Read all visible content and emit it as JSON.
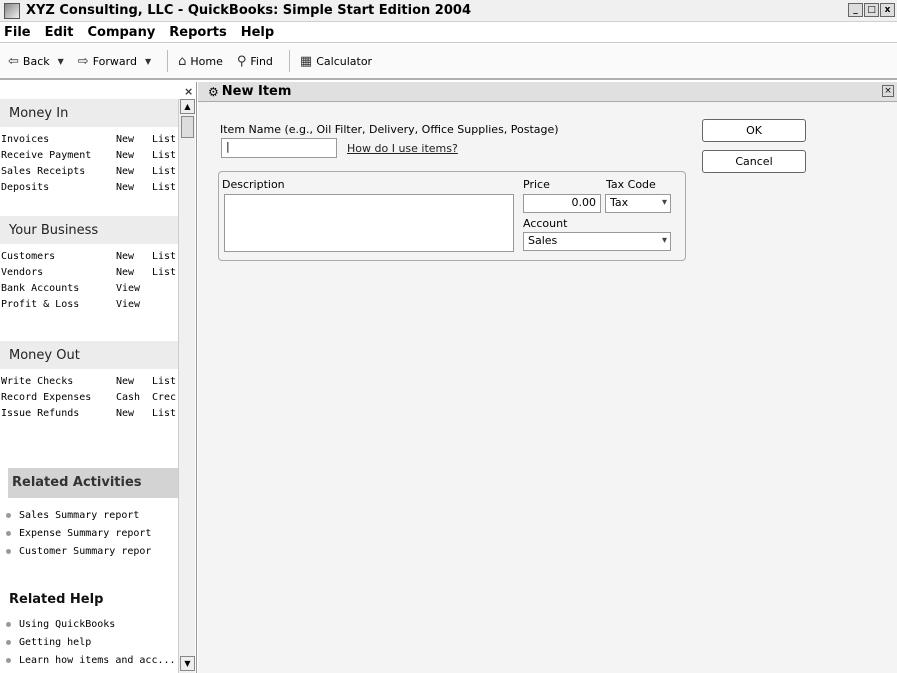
{
  "window": {
    "title": "XYZ Consulting, LLC - QuickBooks: Simple Start Edition 2004",
    "controls": [
      "_",
      "□",
      "x"
    ]
  },
  "menu": [
    "File",
    "Edit",
    "Company",
    "Reports",
    "Help"
  ],
  "toolbar": {
    "back": "Back",
    "forward": "Forward",
    "home": "Home",
    "find": "Find",
    "calculator": "Calculator"
  },
  "navigator": {
    "close": "×",
    "sections": [
      {
        "title": "Money In",
        "rows": [
          {
            "label": "Invoices",
            "a": "New",
            "b": "List"
          },
          {
            "label": "Receive Payment",
            "a": "New",
            "b": "List"
          },
          {
            "label": "Sales Receipts",
            "a": "New",
            "b": "List"
          },
          {
            "label": "Deposits",
            "a": "New",
            "b": "List"
          }
        ]
      },
      {
        "title": "Your Business",
        "rows": [
          {
            "label": "Customers",
            "a": "New",
            "b": "List"
          },
          {
            "label": "Vendors",
            "a": "New",
            "b": "List"
          },
          {
            "label": "Bank Accounts",
            "a": "View",
            "b": ""
          },
          {
            "label": "Profit & Loss",
            "a": "View",
            "b": ""
          }
        ]
      },
      {
        "title": "Money Out",
        "rows": [
          {
            "label": "Write Checks",
            "a": "New",
            "b": "List"
          },
          {
            "label": "Record Expenses",
            "a": "Cash",
            "b": "Crec"
          },
          {
            "label": "Issue Refunds",
            "a": "New",
            "b": "List"
          }
        ]
      }
    ],
    "related_activities": {
      "title": "Related Activities",
      "items": [
        "Sales Summary report",
        "Expense Summary report",
        "Customer Summary repor"
      ]
    },
    "related_help": {
      "title": "Related Help",
      "items": [
        "Using QuickBooks",
        "Getting help",
        "Learn how items and acc..."
      ]
    }
  },
  "new_item": {
    "title": "New Item",
    "item_name_label": "Item Name (e.g., Oil Filter, Delivery, Office Supplies, Postage)",
    "item_name_value": "|",
    "help_link": "How do I use items?",
    "description_label": "Description",
    "description_value": "",
    "price_label": "Price",
    "price_value": "0.00",
    "tax_code_label": "Tax Code",
    "tax_code_value": "Tax",
    "account_label": "Account",
    "account_value": "Sales",
    "ok_label": "OK",
    "cancel_label": "Cancel"
  }
}
